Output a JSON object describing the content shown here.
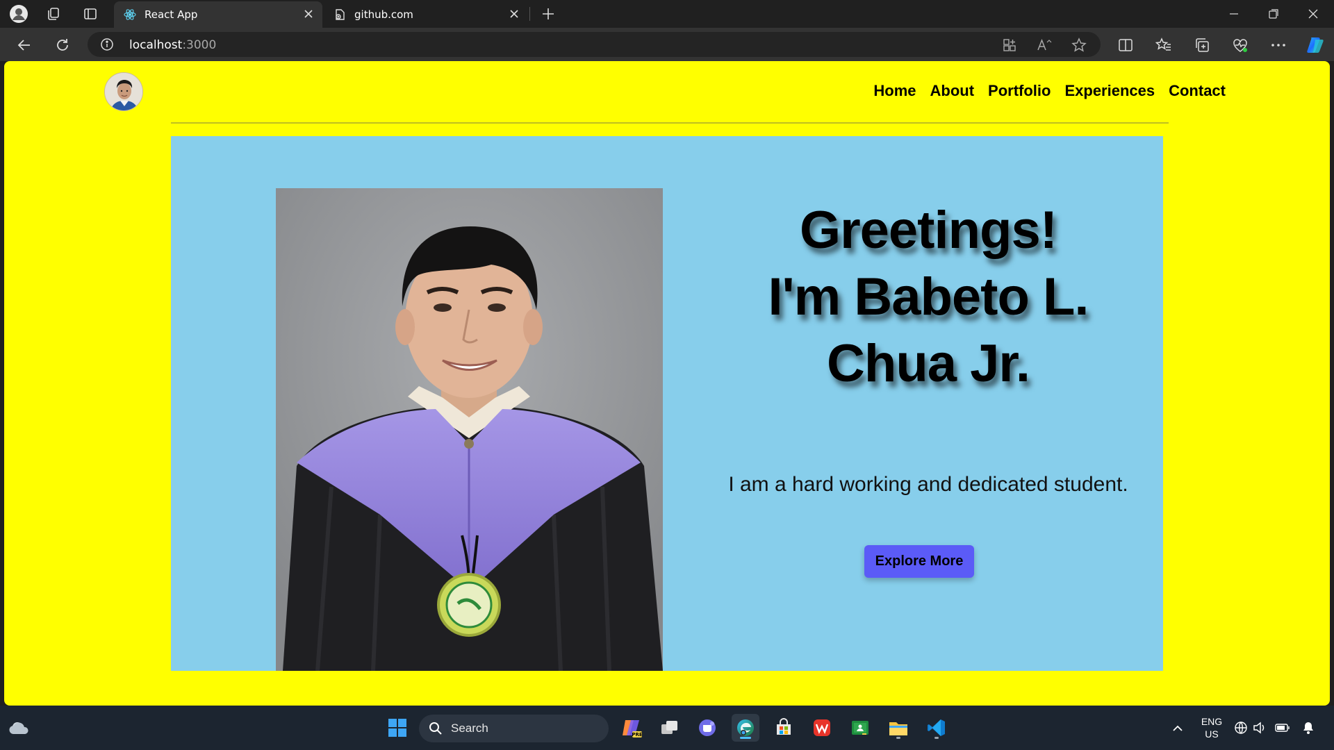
{
  "browser": {
    "tabs": [
      {
        "label": "React App",
        "active": true
      },
      {
        "label": "github.com",
        "active": false
      }
    ],
    "url_host": "localhost",
    "url_port": ":3000"
  },
  "site": {
    "nav": [
      "Home",
      "About",
      "Portfolio",
      "Experiences",
      "Contact"
    ],
    "hero": {
      "line1": "Greetings!",
      "line2": "I'm Babeto L.",
      "line3": "Chua Jr.",
      "tagline": "I am a hard working and dedicated student.",
      "cta": "Explore More"
    },
    "colors": {
      "page_bg": "#ffff00",
      "hero_bg": "#87ceeb",
      "button_bg": "#5b5bf7"
    }
  },
  "taskbar": {
    "search_label": "Search",
    "lang": "ENG",
    "region": "US",
    "apps": [
      "copilot-icon",
      "task-view-icon",
      "teams-icon",
      "edge-icon",
      "store-icon",
      "wps-icon",
      "sheets-icon",
      "file-explorer-icon",
      "vscode-icon"
    ]
  }
}
